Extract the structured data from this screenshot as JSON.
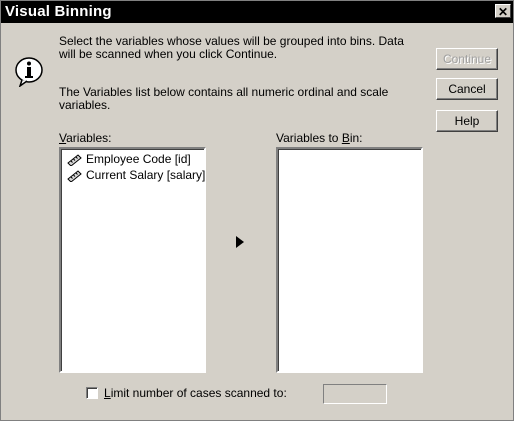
{
  "window": {
    "title": "Visual Binning",
    "close_glyph": "✕"
  },
  "intro": {
    "line1": "Select the variables whose values will be grouped into bins.  Data",
    "line2": "will be scanned when you click Continue.",
    "line3": "The Variables list below contains all numeric ordinal and scale",
    "line4": "variables."
  },
  "buttons": {
    "continue": "Continue",
    "cancel": "Cancel",
    "help": "Help"
  },
  "variables_list": {
    "label_accel": "V",
    "label_rest": "ariables:",
    "items": [
      {
        "label": "Employee Code [id]",
        "icon": "ruler-icon"
      },
      {
        "label": "Current Salary [salary]",
        "icon": "ruler-icon"
      }
    ]
  },
  "bin_list": {
    "label_pre": "Variables to ",
    "label_accel": "B",
    "label_post": "in:"
  },
  "limit": {
    "label_accel": "L",
    "label_rest": "imit number of cases scanned to:",
    "value": ""
  }
}
